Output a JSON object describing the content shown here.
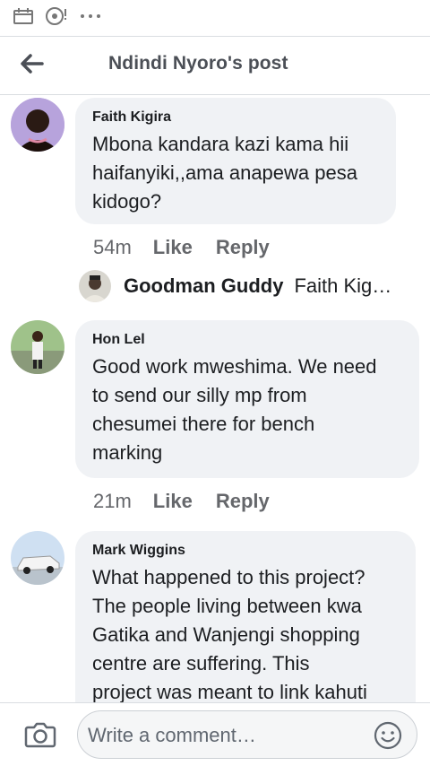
{
  "header": {
    "title": "Ndindi Nyoro's post"
  },
  "comments": [
    {
      "author": "Faith Kigira",
      "text": "Mbona kandara kazi kama hii\nhaifanyiki,,ama anapewa pesa\nkidogo?",
      "time": "54m",
      "like_label": "Like",
      "reply_label": "Reply",
      "reply_preview": {
        "author": "Goodman Guddy",
        "text": "Faith Kig…"
      }
    },
    {
      "author": "Hon Lel",
      "text": "Good work mweshima. We need\nto send our silly mp from\nchesumei there for bench\nmarking",
      "time": "21m",
      "like_label": "Like",
      "reply_label": "Reply"
    },
    {
      "author": "Mark Wiggins",
      "text": "What happened to this project?\nThe people living between kwa\nGatika and Wanjengi shopping\ncentre are suffering. This\nproject was meant to link kahuti"
    }
  ],
  "composer": {
    "placeholder": "Write a comment…"
  },
  "icons": {
    "back": "arrow-left-icon",
    "camera": "camera-icon",
    "emoji": "smiley-icon"
  },
  "colors": {
    "bubble": "#f0f2f5",
    "secondary_text": "#65676b",
    "title": "#4b4f56"
  }
}
